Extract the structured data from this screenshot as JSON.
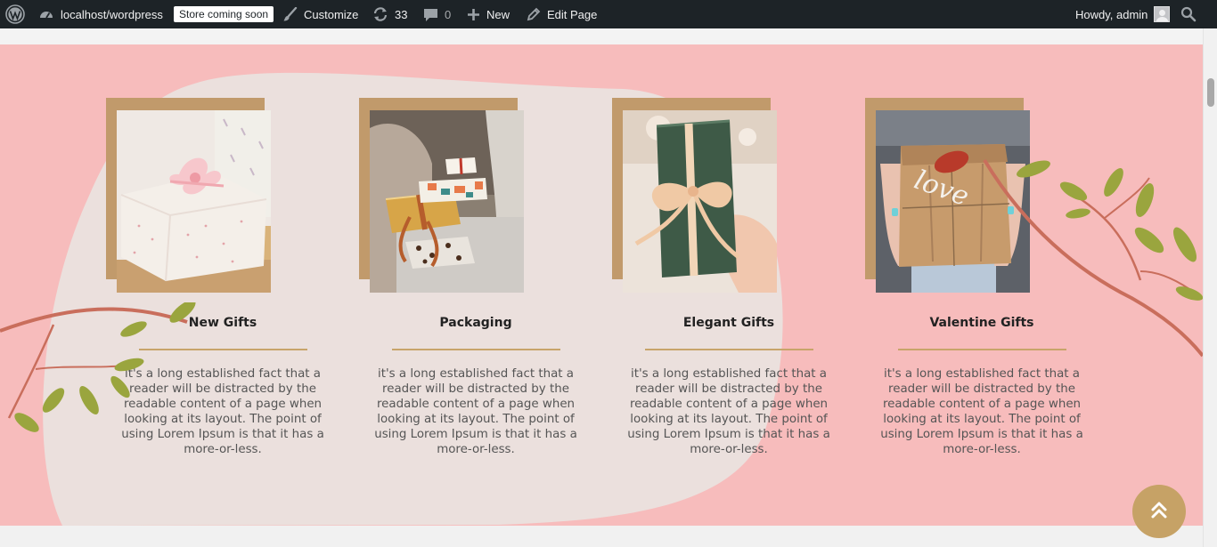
{
  "adminbar": {
    "site": "localhost/wordpress",
    "store_badge": "Store coming soon",
    "customize": "Customize",
    "updates": "33",
    "comments": "0",
    "new": "New",
    "edit_page": "Edit Page",
    "howdy": "Howdy, admin"
  },
  "cards": [
    {
      "title": "New Gifts",
      "desc": "it's a long established fact that a reader will be distracted by the readable content of a page when looking at its layout. The point of using Lorem Ipsum is that it has a more-or-less."
    },
    {
      "title": "Packaging",
      "desc": "it's a long established fact that a reader will be distracted by the readable content of a page when looking at its layout. The point of using Lorem Ipsum is that it has a more-or-less."
    },
    {
      "title": "Elegant Gifts",
      "desc": "it's a long established fact that a reader will be distracted by the readable content of a page when looking at its layout. The point of using Lorem Ipsum is that it has a more-or-less."
    },
    {
      "title": "Valentine Gifts",
      "desc": "it's a long established fact that a reader will be distracted by the readable content of a page when looking at its layout. The point of using Lorem Ipsum is that it has a more-or-less."
    }
  ],
  "photos": {
    "love_tag": "love"
  },
  "colors": {
    "adminbar": "#1d2327",
    "section_bg": "#f7bcbc",
    "blob": "#ebe0dd",
    "frame": "#c19a6b",
    "accent": "#c6a266"
  },
  "icons": {
    "wp": "wordpress-logo-icon",
    "site": "dashboard-icon",
    "customize": "paintbrush-icon",
    "updates": "refresh-icon",
    "comments": "comment-icon",
    "new": "plus-icon",
    "edit": "pencil-icon",
    "search": "search-icon",
    "scroll_top": "chevron-double-up-icon"
  }
}
